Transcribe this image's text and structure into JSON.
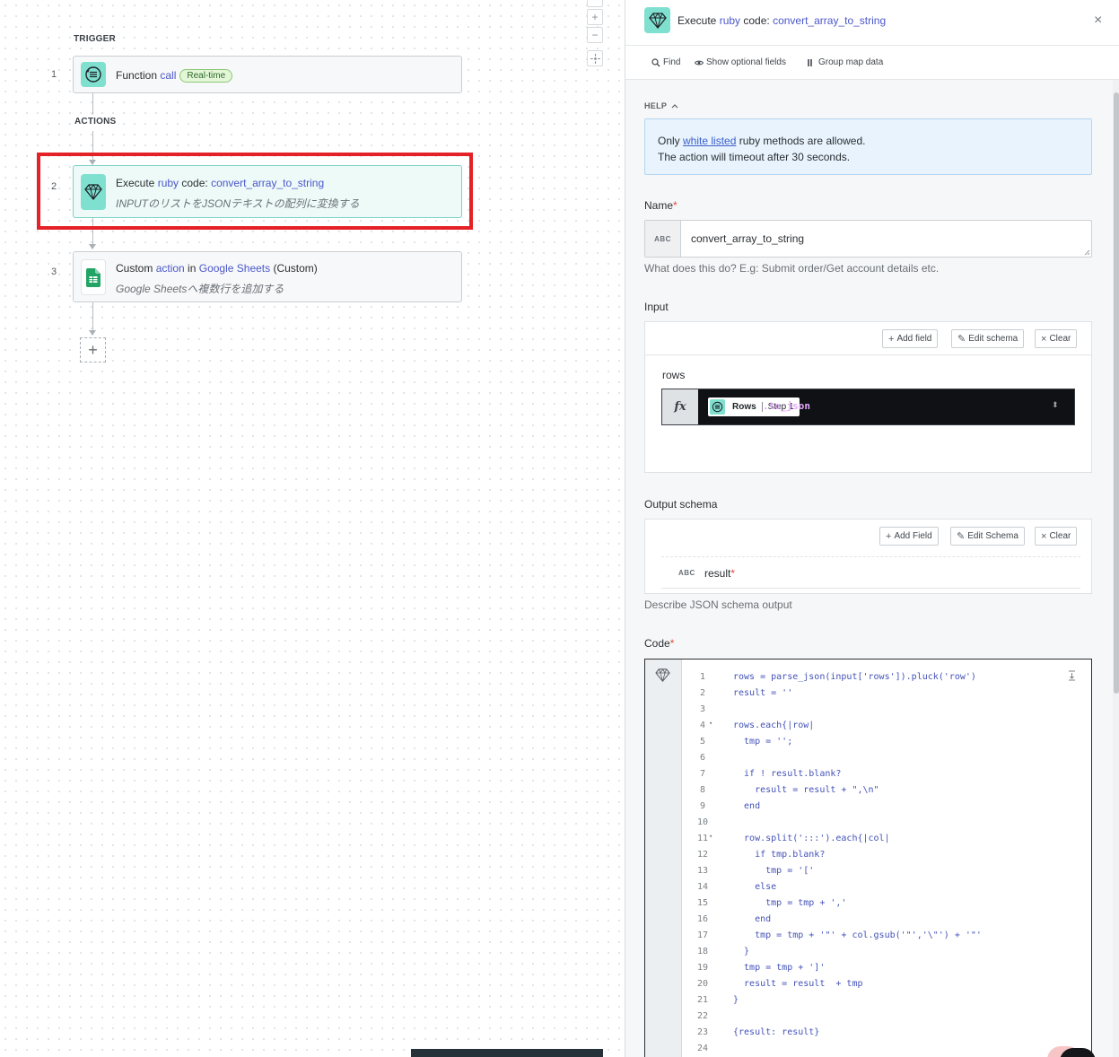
{
  "canvas": {
    "trigger_label": "TRIGGER",
    "actions_label": "ACTIONS",
    "zoom_in": "+",
    "zoom_out": "−",
    "add_step": "+",
    "steps": [
      {
        "num": "1",
        "title_a": "Function ",
        "title_kw": "call",
        "badge": "Real-time",
        "icon": "function-call-icon"
      },
      {
        "num": "2",
        "title_a": "Execute ",
        "title_kw": "ruby",
        "title_b": " code: ",
        "title_kw2": "convert_array_to_string",
        "subtitle": "INPUTのリストをJSONテキストの配列に変換する",
        "icon": "ruby-gem-icon"
      },
      {
        "num": "3",
        "title_a": "Custom ",
        "title_kw": "action",
        "title_b": " in ",
        "title_kw2": "Google Sheets",
        "title_c": " (Custom)",
        "subtitle": "Google Sheetsへ複数行を追加する",
        "icon": "google-sheets-icon"
      }
    ]
  },
  "panel": {
    "title_a": "Execute ",
    "title_kw": "ruby",
    "title_b": " code: ",
    "title_kw2": "convert_array_to_string",
    "close": "×",
    "toolbar": {
      "find": "Find",
      "optional": "Show optional fields",
      "group": "Group map data"
    },
    "help": {
      "label": "HELP",
      "line1_a": "Only ",
      "line1_link": "white listed",
      "line1_b": " ruby methods are allowed.",
      "line2": "The action will timeout after 30 seconds."
    },
    "name": {
      "label": "Name",
      "required": "*",
      "type": "ABC",
      "value": "convert_array_to_string",
      "hint": "What does this do? E.g: Submit order/Get account details etc."
    },
    "input": {
      "label": "Input",
      "add_field": "Add field",
      "edit_schema": "Edit schema",
      "clear": "Clear",
      "field_name": "rows",
      "fx": "fx",
      "pill_name": "Rows",
      "pill_step": "Step 1",
      "method": ".to_json"
    },
    "output": {
      "label": "Output schema",
      "add_field": "Add Field",
      "edit_schema": "Edit Schema",
      "clear": "Clear",
      "field_type": "ABC",
      "field_name": "result",
      "required": "*",
      "hint": "Describe JSON schema output"
    },
    "code": {
      "label": "Code",
      "required": "*",
      "lines": [
        "rows = parse_json(input['rows']).pluck('row')",
        "result = ''",
        "",
        "rows.each{|row|",
        "  tmp = '';",
        "",
        "  if ! result.blank?",
        "    result = result + \",\\n\"",
        "  end",
        "",
        "  row.split(':::').each{|col|",
        "    if tmp.blank?",
        "      tmp = '['",
        "    else",
        "      tmp = tmp + ','",
        "    end",
        "    tmp = tmp + '\"' + col.gsub('\"','\\\"') + '\"'",
        "  }",
        "  tmp = tmp + ']'",
        "  result = result  + tmp",
        "}",
        "",
        "{result: result}",
        ""
      ]
    }
  }
}
